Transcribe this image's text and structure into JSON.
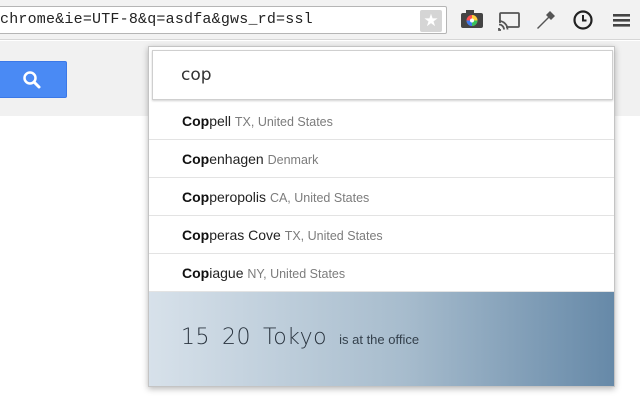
{
  "toolbar": {
    "url": "chrome&ie=UTF-8&q=asdfa&gws_rd=ssl",
    "star_icon": "star-icon",
    "extensions": [
      "color-picker-icon",
      "cast-icon",
      "key-icon",
      "clock-icon",
      "menu-icon"
    ]
  },
  "page": {
    "search_icon": "magnifier-icon"
  },
  "popup": {
    "query": "cop",
    "results": [
      {
        "match": "Cop",
        "rest": "pell",
        "sub": "TX, United States"
      },
      {
        "match": "Cop",
        "rest": "enhagen",
        "sub": "Denmark"
      },
      {
        "match": "Cop",
        "rest": "peropolis",
        "sub": "CA, United States"
      },
      {
        "match": "Cop",
        "rest": "peras Cove",
        "sub": "TX, United States"
      },
      {
        "match": "Cop",
        "rest": "iague",
        "sub": "NY, United States"
      }
    ],
    "footer": {
      "hour": "15",
      "minute": "20",
      "city": "Tokyo",
      "status": "is at the office"
    },
    "colors": {
      "gradient_start": "#d7e1ea",
      "gradient_end": "#6689a8"
    }
  }
}
